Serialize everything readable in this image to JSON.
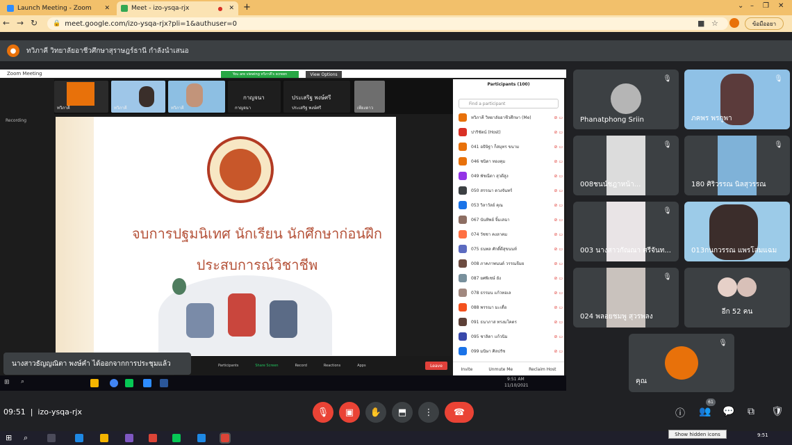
{
  "browser": {
    "tabs": [
      {
        "title": "Launch Meeting - Zoom",
        "color": "#2d8cff"
      },
      {
        "title": "Meet - izo-ysqa-rjx",
        "color": "#34a853"
      }
    ],
    "url": "meet.google.com/izo-ysqa-rjx?pli=1&authuser=0",
    "profile_label": "ข้อมืออยา"
  },
  "presenting": {
    "text": "ทวิภาคี วิทยาลัยอาชีวศึกษาสุราษฎร์ธานี กำลังนำเสนอ"
  },
  "zoom": {
    "window_title": "Zoom Meeting",
    "banner": "You are viewing ทวิภาคี's screen",
    "view_options": "View Options",
    "recording": "Recording",
    "thumbnails": [
      {
        "label": "ทวิภาคี"
      },
      {
        "label": "ทวิภาคี"
      },
      {
        "label": "ทวิภาคี"
      },
      {
        "name": "กาญจนา",
        "label": "กาญจนา"
      },
      {
        "name": "ประเสริฐ พงษ์ศรี",
        "label": "ประเสริฐ พงษ์ศรี"
      },
      {
        "label": "เพียงดาว"
      }
    ],
    "participants_title": "Participants (100)",
    "search_placeholder": "Find a participant",
    "participants": [
      {
        "name": "ทวิภาคี วิทยาลัยอาชีวศึกษา (Me)",
        "color": "#e8710a"
      },
      {
        "name": "ปาริชัตน์ (Host)",
        "color": "#d93025"
      },
      {
        "name": "041 อธิษิฐา ก็สมุทร ขนาม",
        "color": "#e8710a"
      },
      {
        "name": "046 ชนิดา ทองคุม",
        "color": "#e8710a"
      },
      {
        "name": "049 พัชณีดา สุวดีสูง",
        "color": "#9334e6"
      },
      {
        "name": "050 สรรณา ดวงจันทร์",
        "color": "#3c4043"
      },
      {
        "name": "053 วิลาวัลย์ คุณ",
        "color": "#1a73e8"
      },
      {
        "name": "067 นันทิพย์ จิ้มเสฉา",
        "color": "#8d6e63"
      },
      {
        "name": "074 วัชชา คงลาคม",
        "color": "#ff7043"
      },
      {
        "name": "075 ธนพล ศักดิ์ดีสุขนนท์",
        "color": "#5c6bc0"
      },
      {
        "name": "008 ภาคภาพนนต์ วรรณจีมย",
        "color": "#6d4c41"
      },
      {
        "name": "087 ยศพิเชษ์ ยัง",
        "color": "#78909c"
      },
      {
        "name": "078 ธรรมน แก้วทอเล",
        "color": "#a1887f"
      },
      {
        "name": "088 พรรณา มะเดื่อ",
        "color": "#f4511e"
      },
      {
        "name": "091 ธนาภาส ทรงมโคตร",
        "color": "#5d4037"
      },
      {
        "name": "095 ชาลิดา แก้วนิม",
        "color": "#3949ab"
      },
      {
        "name": "099 มนิษา ศิลปรัช",
        "color": "#1a73e8"
      }
    ],
    "footer": [
      "Invite",
      "Unmute Me",
      "Reclaim Host"
    ],
    "toolbar": [
      "Participants",
      "Share Screen",
      "Record",
      "Reactions",
      "Apps"
    ],
    "leave_label": "Leave",
    "inner_clock": "9:51 AM",
    "inner_date": "11/10/2021"
  },
  "slide": {
    "line1": "จบการปฐมนิเทศ นักเรียน นักศึกษาก่อนฝึก",
    "line2": "ประสบการณ์วิชาชีพ"
  },
  "toast": "นางสาวธัญญณิตา พงษ์คำ ได้ออกจากการประชุมแล้ว",
  "tiles": [
    {
      "name": "Phanatphong Sriin"
    },
    {
      "name": "ภคพร พรกูพา"
    },
    {
      "name": "008ชนน์ชฎาหน้า..."
    },
    {
      "name": "180 ศิริวรรณ นิลสุวรรณ"
    },
    {
      "name": "003 นางสาวกัณณา ศรีจันท..."
    },
    {
      "name": "013กนกวรรณ แพรโสมแฉม"
    },
    {
      "name": "024 พลอยชมพู สุวรพลง"
    },
    {
      "name": "อีก 52 คน"
    },
    {
      "name": "คุณ"
    }
  ],
  "bottom": {
    "time": "09:51",
    "meeting_code": "izo-ysqa-rjx",
    "people_badge": "61",
    "tooltip": "Show hidden icons",
    "clock": "9:51"
  }
}
